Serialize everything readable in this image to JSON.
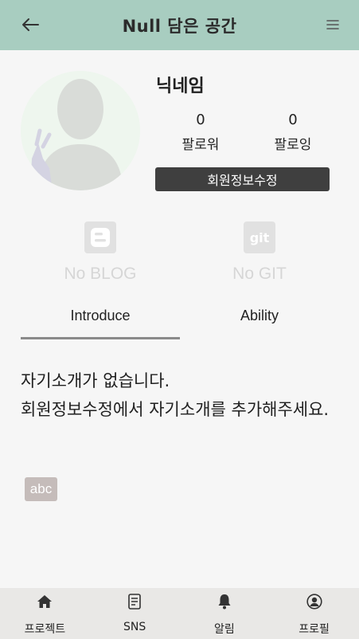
{
  "header": {
    "title": "Null 담은 공간",
    "back_icon": "arrow-left-icon",
    "menu_icon": "hamburger-menu-icon"
  },
  "profile": {
    "avatar_icon": "default-avatar-icon",
    "nickname": "닉네임",
    "followers": {
      "count": "0",
      "label": "팔로워"
    },
    "following": {
      "count": "0",
      "label": "팔로잉"
    },
    "edit_button_label": "회원정보수정"
  },
  "links": [
    {
      "icon": "blogger-icon",
      "label": "No BLOG"
    },
    {
      "icon": "git-icon",
      "label": "No GIT"
    }
  ],
  "tabs": [
    {
      "label": "Introduce",
      "active": true
    },
    {
      "label": "Ability",
      "active": false
    }
  ],
  "introduce": {
    "text": " 자기소개가 없습니다.\n 회원정보수정에서 자기소개를 추가해주세요.",
    "tag": "abc"
  },
  "bottom_nav": [
    {
      "icon": "home-icon",
      "label": "프로젝트"
    },
    {
      "icon": "document-icon",
      "label": "SNS"
    },
    {
      "icon": "bell-icon",
      "label": "알림"
    },
    {
      "icon": "user-circle-icon",
      "label": "프로필"
    }
  ],
  "colors": {
    "header_bg": "#a8cdc0",
    "edit_button_bg": "#3f3f3f",
    "tag_bg": "#c5bcba",
    "nav_bg": "#e9e8e6",
    "page_bg": "#f6f6f6"
  }
}
